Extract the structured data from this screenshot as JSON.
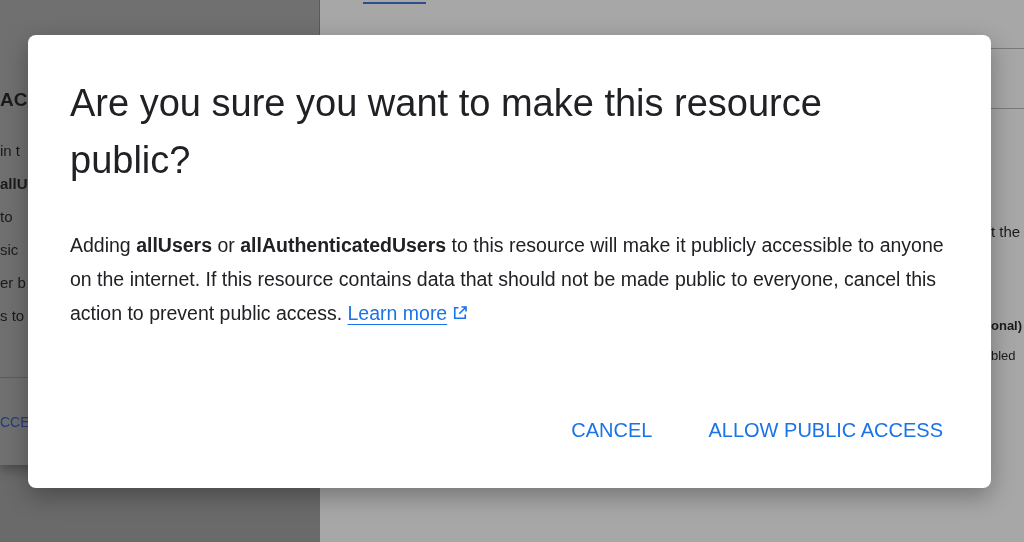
{
  "background": {
    "left_panel": {
      "heading": "AC",
      "lines": [
        {
          "text": "in t",
          "bold": false
        },
        {
          "text": "allU",
          "bold": true
        },
        {
          "text": "to",
          "bold": false
        },
        {
          "text": "sic",
          "bold": false
        },
        {
          "text": "er b",
          "bold": false
        },
        {
          "text": "s to",
          "bold": false
        }
      ],
      "action": "CCE"
    },
    "right_panel": {
      "lines": [
        {
          "text": "t the",
          "bold": false
        },
        {
          "text": "onal)",
          "bold": true
        },
        {
          "text": "bled",
          "bold": false
        }
      ]
    }
  },
  "dialog": {
    "title": "Are you sure you want to make this resource public?",
    "body": "Adding **allUsers** or **allAuthenticatedUsers** to this resource will make it publicly accessible to anyone on the internet. If this resource contains data that should not be made public to everyone, cancel this action to prevent public access.",
    "link": "Learn more",
    "buttons": [
      "CANCEL",
      "ALLOW PUBLIC ACCESS"
    ]
  }
}
